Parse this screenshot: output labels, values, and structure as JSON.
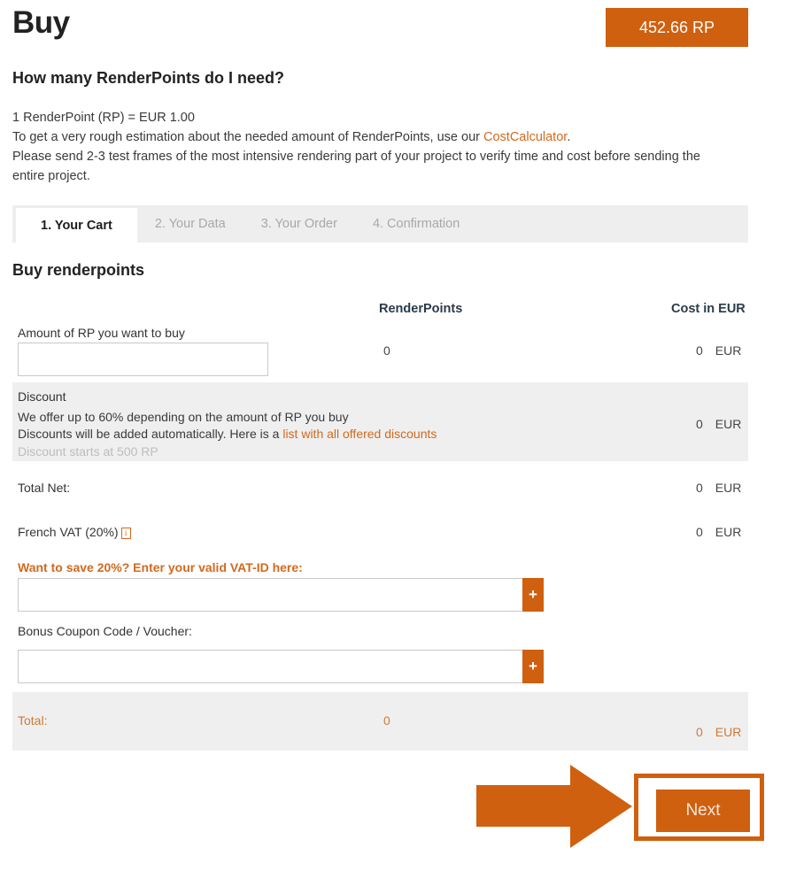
{
  "header": {
    "title": "Buy",
    "rp_badge": "452.66 RP",
    "badge_color": "#cf600f"
  },
  "intro": {
    "heading": "How many RenderPoints do I need?",
    "line1": "1 RenderPoint (RP) = EUR 1.00",
    "line2_prefix": "To get a very rough estimation about the needed amount of RenderPoints, use our ",
    "line2_link": "CostCalculator",
    "line2_suffix": ".",
    "line3": "Please send 2-3 test frames of the most intensive rendering part of your project to verify time and cost before sending the entire project."
  },
  "tabs": [
    {
      "label": "1. Your Cart",
      "active": true
    },
    {
      "label": "2. Your Data",
      "active": false
    },
    {
      "label": "3. Your Order",
      "active": false
    },
    {
      "label": "4. Confirmation",
      "active": false
    }
  ],
  "cart": {
    "heading": "Buy renderpoints",
    "columns": {
      "renderpoints": "RenderPoints",
      "cost": "Cost in EUR"
    },
    "amount_row": {
      "label": "Amount of RP you want to buy",
      "input_value": "",
      "input_placeholder": "",
      "renderpoints": "0",
      "cost": "0",
      "currency": "EUR"
    },
    "discount_row": {
      "title": "Discount",
      "line1": "We offer up to 60% depending on the amount of RP you buy",
      "line2_prefix": "Discounts will be added automatically. Here is a ",
      "line2_link": "list with all offered discounts",
      "line3": "Discount starts at 500 RP",
      "cost": "0",
      "currency": "EUR"
    },
    "total_net_row": {
      "label": "Total Net:",
      "cost": "0",
      "currency": "EUR"
    },
    "vat_row": {
      "label": "French VAT (20%)",
      "info_icon": "info-icon",
      "info_glyph": "i",
      "cost": "0",
      "currency": "EUR"
    },
    "vat_id_field": {
      "label": "Want to save 20%? Enter your valid VAT-ID here:",
      "value": "",
      "placeholder": "",
      "add_button": "+"
    },
    "coupon_field": {
      "label": "Bonus Coupon Code / Voucher:",
      "value": "",
      "placeholder": "",
      "add_button": "+"
    },
    "total_row": {
      "label": "Total:",
      "renderpoints": "0",
      "cost": "0",
      "currency": "EUR"
    }
  },
  "footer": {
    "next_label": "Next",
    "arrow_icon": "right-arrow-icon",
    "highlight_color": "#cf600f"
  }
}
